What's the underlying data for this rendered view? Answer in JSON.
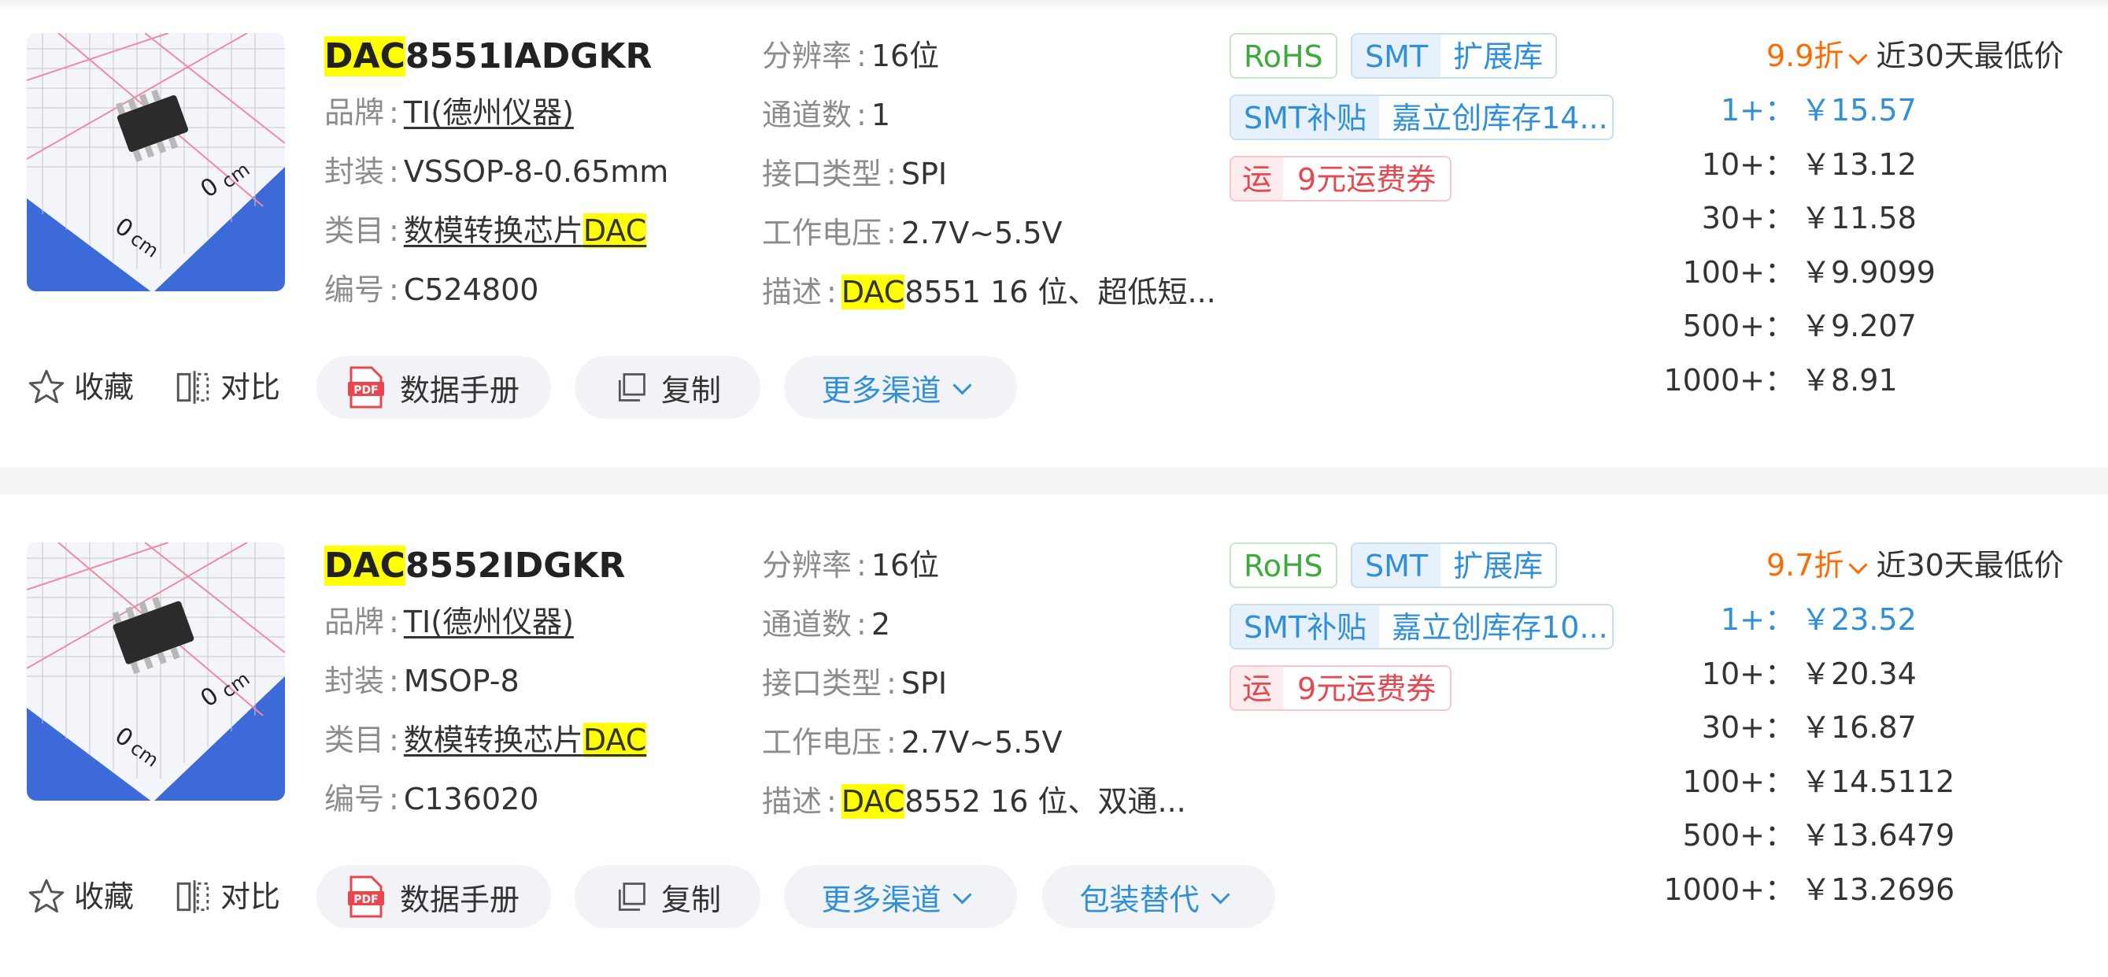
{
  "products": [
    {
      "title_hl": "DAC",
      "title_rest": "8551IADGKR",
      "brand_label": "品牌",
      "brand": "TI(德州仪器)",
      "package_label": "封装",
      "package": "VSSOP-8-0.65mm",
      "category_label": "类目",
      "category_text": "数模转换芯片",
      "category_hl": "DAC",
      "code_label": "编号",
      "code": "C524800",
      "resolution_label": "分辨率",
      "resolution": "16位",
      "channels_label": "通道数",
      "channels": "1",
      "interface_label": "接口类型",
      "interface": "SPI",
      "voltage_label": "工作电压",
      "voltage": "2.7V~5.5V",
      "desc_label": "描述",
      "desc_hl": "DAC",
      "desc_rest": "8551 16 位、超低短...",
      "tag_rohs": "RoHS",
      "tag_smt": "SMT",
      "tag_lib": "扩展库",
      "tag_subsidy": "SMT补贴",
      "tag_stock": "嘉立创库存14...",
      "tag_ship": "运",
      "tag_coupon": "9元运费券",
      "discount": "9.9折",
      "discount_note": "近30天最低价",
      "prices": [
        {
          "qty": "1+：",
          "price": "￥15.57"
        },
        {
          "qty": "10+：",
          "price": "￥13.12"
        },
        {
          "qty": "30+：",
          "price": "￥11.58"
        },
        {
          "qty": "100+：",
          "price": "￥9.9099"
        },
        {
          "qty": "500+：",
          "price": "￥9.207"
        },
        {
          "qty": "1000+：",
          "price": "￥8.91"
        }
      ],
      "actions": {
        "favorite": "收藏",
        "compare": "对比",
        "datasheet": "数据手册",
        "copy": "复制",
        "more_channels": "更多渠道"
      }
    },
    {
      "title_hl": "DAC",
      "title_rest": "8552IDGKR",
      "brand_label": "品牌",
      "brand": "TI(德州仪器)",
      "package_label": "封装",
      "package": "MSOP-8",
      "category_label": "类目",
      "category_text": "数模转换芯片",
      "category_hl": "DAC",
      "code_label": "编号",
      "code": "C136020",
      "resolution_label": "分辨率",
      "resolution": "16位",
      "channels_label": "通道数",
      "channels": "2",
      "interface_label": "接口类型",
      "interface": "SPI",
      "voltage_label": "工作电压",
      "voltage": "2.7V~5.5V",
      "desc_label": "描述",
      "desc_hl": "DAC",
      "desc_rest": "8552 16 位、双通...",
      "tag_rohs": "RoHS",
      "tag_smt": "SMT",
      "tag_lib": "扩展库",
      "tag_subsidy": "SMT补贴",
      "tag_stock": "嘉立创库存10...",
      "tag_ship": "运",
      "tag_coupon": "9元运费券",
      "discount": "9.7折",
      "discount_note": "近30天最低价",
      "prices": [
        {
          "qty": "1+：",
          "price": "￥23.52"
        },
        {
          "qty": "10+：",
          "price": "￥20.34"
        },
        {
          "qty": "30+：",
          "price": "￥16.87"
        },
        {
          "qty": "100+：",
          "price": "￥14.5112"
        },
        {
          "qty": "500+：",
          "price": "￥13.6479"
        },
        {
          "qty": "1000+：",
          "price": "￥13.2696"
        }
      ],
      "actions": {
        "favorite": "收藏",
        "compare": "对比",
        "datasheet": "数据手册",
        "copy": "复制",
        "more_channels": "更多渠道",
        "package_alt": "包装替代"
      }
    }
  ],
  "thumb_text": {
    "cm": "cm",
    "zero": "0"
  },
  "colors": {
    "accent_blue": "#2f8fd8",
    "discount_orange": "#ff6a00",
    "highlight": "#ffff00",
    "rohs_green": "#3daa3d",
    "coupon_red": "#e8474f"
  }
}
